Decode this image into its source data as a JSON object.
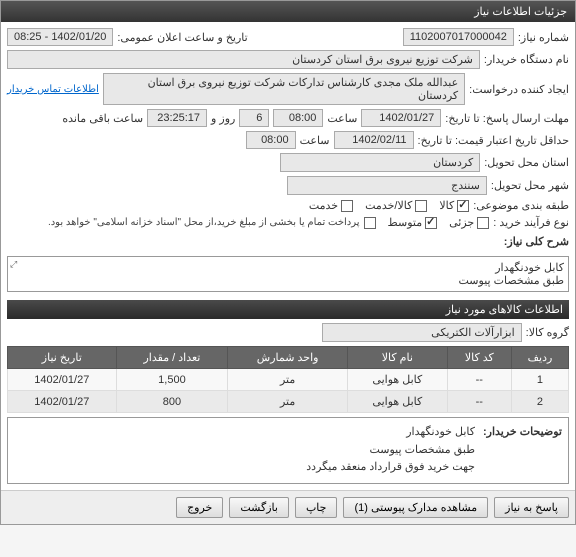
{
  "titlebar": "جزئیات اطلاعات نیاز",
  "labels": {
    "reqNo": "شماره نیاز:",
    "pubDateTime": "تاریخ و ساعت اعلان عمومی:",
    "buyerOrg": "نام دستگاه خریدار:",
    "creator": "ایجاد کننده درخواست:",
    "contactLink": "اطلاعات تماس خریدار",
    "deadlineFrom": "مهلت ارسال پاسخ: تا تاریخ:",
    "hourWord": "ساعت",
    "dayAnd": "روز و",
    "remaining": "ساعت باقی مانده",
    "validFrom": "حداقل تاریخ اعتبار قیمت: تا تاریخ:",
    "province": "استان محل تحویل:",
    "city": "شهر محل تحویل:",
    "category": "طبقه بندی موضوعی:",
    "kala": "کالا",
    "khadamat": "کالا/خدمت",
    "khadmat": "خدمت",
    "procType": "نوع فرآیند خرید :",
    "low": "جزئی",
    "mid": "متوسط",
    "payNote": "پرداخت تمام یا بخشی از مبلغ خرید،از محل \"اسناد خزانه اسلامی\" خواهد بود.",
    "desc": "شرح کلی نیاز:",
    "itemsHeader": "اطلاعات کالاهای مورد نیاز",
    "group": "گروه کالا:",
    "buyerNotesLabel": "توضیحات خریدار:"
  },
  "values": {
    "reqNo": "1102007017000042",
    "pubDateTime": "1402/01/20 - 08:25",
    "buyerOrg": "شرکت توزیع نیروی برق استان کردستان",
    "creator": "عبدالله ملک مجدی کارشناس تدارکات شرکت توزیع نیروی برق استان کردستان",
    "deadlineDate": "1402/01/27",
    "deadlineTime": "08:00",
    "remainDays": "6",
    "remainTime": "23:25:17",
    "validDate": "1402/02/11",
    "validTime": "08:00",
    "province": "کردستان",
    "city": "سنندج",
    "desc": "کابل خودنگهدار\nطبق مشخصات پیوست",
    "group": "ابزارآلات الکتریکی",
    "buyerNotes": "کابل خودنگهدار\nطبق مشخصات پیوست\nجهت خرید فوق قرارداد منعقد میگردد"
  },
  "table": {
    "headers": [
      "ردیف",
      "کد کالا",
      "نام کالا",
      "واحد شمارش",
      "تعداد / مقدار",
      "تاریخ نیاز"
    ],
    "rows": [
      {
        "idx": "1",
        "code": "--",
        "name": "کابل هوایی",
        "unit": "متر",
        "qty": "1,500",
        "date": "1402/01/27"
      },
      {
        "idx": "2",
        "code": "--",
        "name": "کابل هوایی",
        "unit": "متر",
        "qty": "800",
        "date": "1402/01/27"
      }
    ]
  },
  "buttons": {
    "reply": "پاسخ به نیاز",
    "attach": "مشاهده مدارک پیوستی (1)",
    "print": "چاپ",
    "back": "بازگشت",
    "exit": "خروج"
  }
}
